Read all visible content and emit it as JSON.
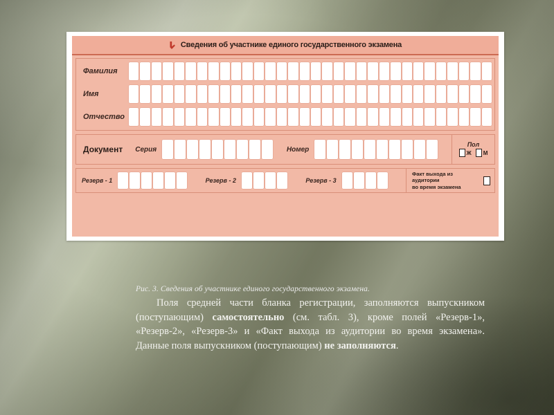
{
  "slide": {
    "background_colors": {
      "base": "#8a8d78",
      "highlight": "#b9bfa6",
      "shadow": "#64694f"
    }
  },
  "figure": {
    "frame_color": "#ffffff",
    "form_color": "#f2b9a6",
    "header_band_color": "#f0ad99",
    "header_rule_color": "#cc6a52",
    "header": {
      "icon": "red-down-arrow-icon",
      "icon_color": "#c0392b",
      "title": "Сведения об участнике единого государственного экзамена"
    },
    "name_rows": [
      {
        "label": "Фамилия",
        "cell_count": 32
      },
      {
        "label": "Имя",
        "cell_count": 32
      },
      {
        "label": "Отчество",
        "cell_count": 32
      }
    ],
    "document_row": {
      "title": "Документ",
      "series_label": "Серия",
      "series_cell_count": 9,
      "number_label": "Номер",
      "number_cell_count": 10
    },
    "gender": {
      "title": "Пол",
      "options": [
        {
          "label": "Ж",
          "checked": false
        },
        {
          "label": "М",
          "checked": false
        }
      ]
    },
    "reserve_row": {
      "groups": [
        {
          "label": "Резерв - 1",
          "cell_count": 6
        },
        {
          "label": "Резерв - 2",
          "cell_count": 4
        },
        {
          "label": "Резерв - 3",
          "cell_count": 4
        }
      ],
      "exit_fact": {
        "line1": "Факт выхода из аудитории",
        "line2": "во время экзамена",
        "checked": false
      }
    }
  },
  "caption": "Рис. 3. Сведения об участнике единого государственного экзамена.",
  "body_text": {
    "part1": "Поля средней части бланка регистрации, заполняются выпускником (поступающим) ",
    "bold1": "самостоятельно",
    "part2": " (см. табл. 3), кроме полей «Резерв-1», «Резерв-2», «Резерв-3» и «Факт выхода из аудитории во время экзамена». Данные поля   выпускником (поступающим) ",
    "bold2": "не заполняются",
    "part3": "."
  }
}
